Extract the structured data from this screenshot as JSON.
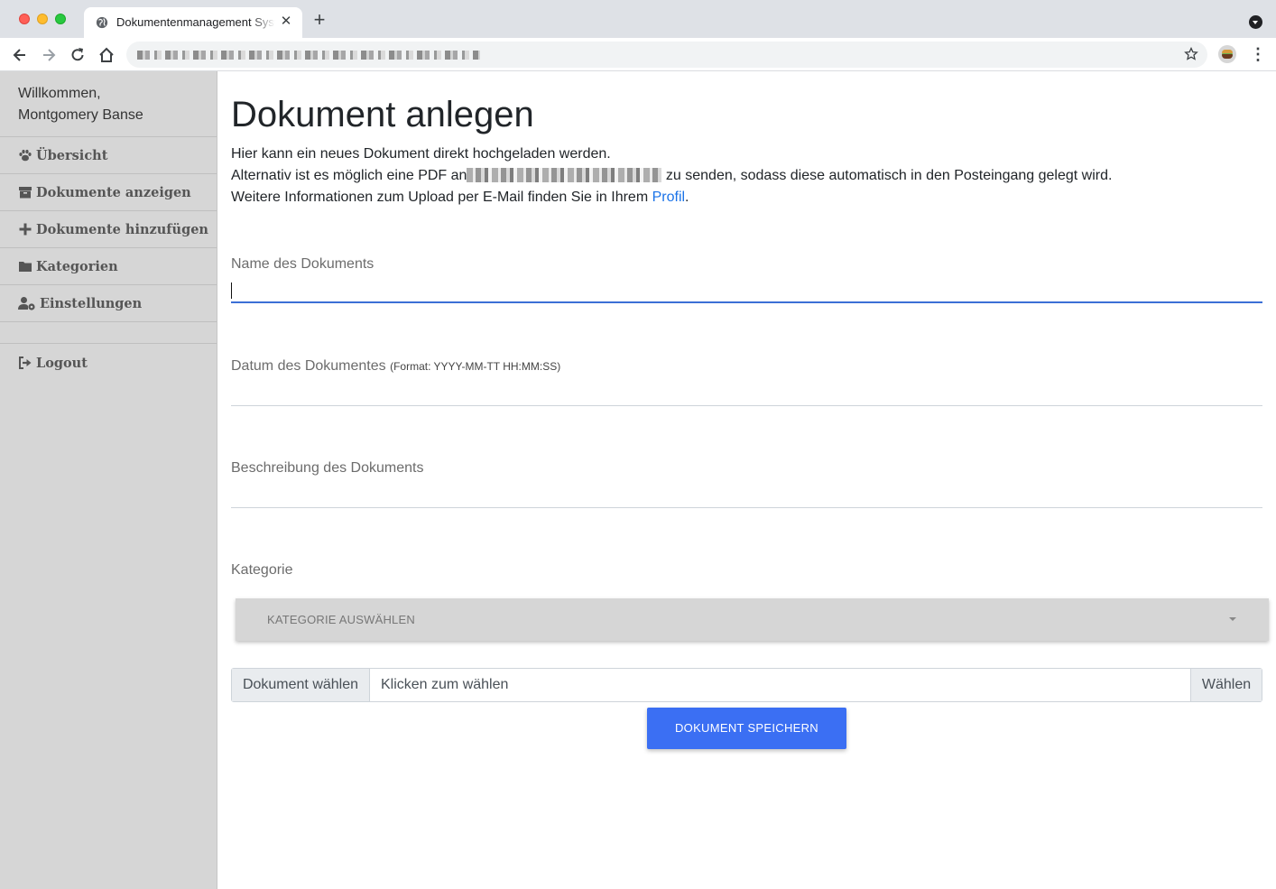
{
  "browser": {
    "tab_title": "Dokumentenmanagement System",
    "tab_close": "✕",
    "new_tab": "+",
    "menu": "⋮"
  },
  "sidebar": {
    "welcome_line1": "Willkommen,",
    "welcome_line2": "Montgomery Banse",
    "items": [
      {
        "label": "Übersicht",
        "icon": "paw-icon"
      },
      {
        "label": "Dokumente anzeigen",
        "icon": "archive-icon"
      },
      {
        "label": "Dokumente hinzufügen",
        "icon": "plus-icon"
      },
      {
        "label": "Kategorien",
        "icon": "folder-icon"
      },
      {
        "label": "Einstellungen",
        "icon": "user-cog-icon"
      }
    ],
    "logout": {
      "label": "Logout",
      "icon": "sign-out-icon"
    }
  },
  "main": {
    "title": "Dokument anlegen",
    "intro_line1": "Hier kann ein neues Dokument direkt hochgeladen werden.",
    "intro_line2_before": "Alternativ ist es möglich eine PDF an",
    "intro_line2_after": " zu senden, sodass diese automatisch in den Posteingang gelegt wird.",
    "intro_line3_before": "Weitere Informationen zum Upload per E-Mail finden Sie in Ihrem ",
    "intro_line3_link": "Profil",
    "intro_line3_after": "."
  },
  "form": {
    "name_label": "Name des Dokuments",
    "name_value": "",
    "date_label": "Datum des Dokumentes",
    "date_hint": "(Format: YYYY-MM-TT HH:MM:SS)",
    "date_value": "",
    "desc_label": "Beschreibung des Dokuments",
    "desc_value": "",
    "category_label": "Kategorie",
    "category_select": "KATEGORIE AUSWÄHLEN",
    "file_prepend": "Dokument wählen",
    "file_placeholder": "Klicken zum wählen",
    "file_button": "Wählen",
    "save_button": "DOKUMENT SPEICHERN"
  },
  "colors": {
    "accent": "#3b6ff3",
    "link": "#1a73e8",
    "sidebar_bg": "#d6d6d6"
  }
}
